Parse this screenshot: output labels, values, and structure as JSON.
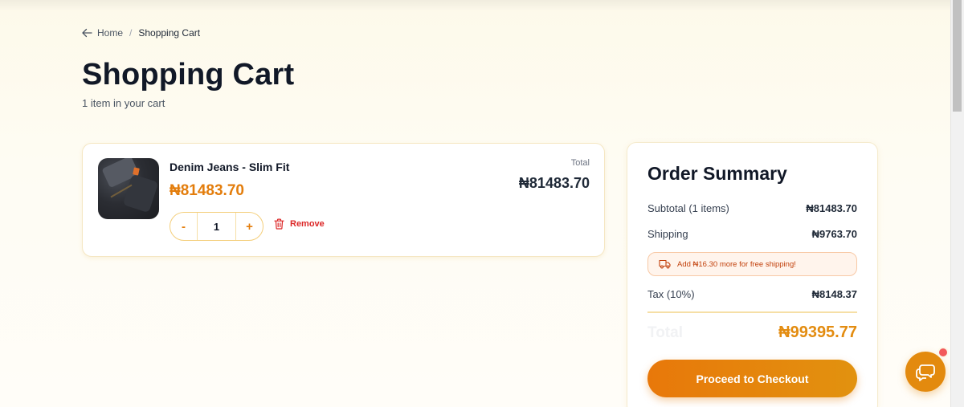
{
  "breadcrumb": {
    "home": "Home",
    "separator": "/",
    "current": "Shopping Cart"
  },
  "page": {
    "title": "Shopping Cart",
    "subtitle": "1 item in your cart"
  },
  "cart": {
    "items": [
      {
        "name": "Denim Jeans - Slim Fit",
        "price": "₦81483.70",
        "quantity": "1",
        "decrement_label": "-",
        "increment_label": "+",
        "remove_label": "Remove",
        "total_label": "Total",
        "total": "₦81483.70",
        "image_icon": "denim-jeans-photo"
      }
    ]
  },
  "summary": {
    "title": "Order Summary",
    "subtotal_label": "Subtotal (1 items)",
    "subtotal": "₦81483.70",
    "shipping_label": "Shipping",
    "shipping": "₦9763.70",
    "free_shipping_note": "Add ₦16.30 more for free shipping!",
    "tax_label": "Tax (10%)",
    "tax": "₦8148.37",
    "total_label": "Total",
    "total": "₦99395.77",
    "checkout_label": "Proceed to Checkout"
  },
  "icons": {
    "back": "arrow-left-icon",
    "remove": "trash-icon",
    "shipping": "truck-icon",
    "chat": "chat-bubble-icon"
  },
  "colors": {
    "accent": "#e37d0c",
    "danger": "#dc2626",
    "notification": "#f25a5a"
  }
}
